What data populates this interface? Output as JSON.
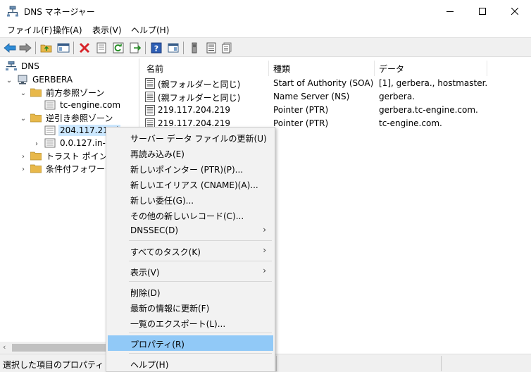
{
  "window": {
    "title": "DNS マネージャー",
    "minimize_glyph": "—",
    "maximize_glyph": "☐",
    "close_glyph": "✕"
  },
  "menubar": {
    "file": "ファイル(F)",
    "action": "操作(A)",
    "view": "表示(V)",
    "help": "ヘルプ(H)"
  },
  "toolbar": {
    "icons": [
      "back-icon",
      "forward-icon",
      "up-folder-icon",
      "show-hide-tree-icon",
      "delete-icon",
      "properties-icon",
      "refresh-icon",
      "export-list-icon",
      "help-icon",
      "console-view-icon",
      "server-icon",
      "record-list-icon",
      "new-record-icon"
    ]
  },
  "tree": {
    "root": "DNS",
    "server": "GERBERA",
    "forward_zones": "前方参照ゾーン",
    "forward_zone_1": "tc-engine.com",
    "reverse_zones": "逆引き参照ゾーン",
    "reverse_zone_1": "204.117.219.i",
    "reverse_zone_2": "0.0.127.in-ad",
    "trust_points": "トラスト ポイント",
    "conditional_forwarders": "条件付フォワーダー"
  },
  "list": {
    "headers": {
      "name": "名前",
      "type": "種類",
      "data": "データ"
    },
    "rows": [
      {
        "name": "(親フォルダーと同じ)",
        "type": "Start of Authority (SOA)",
        "data": "[1], gerbera., hostmaster."
      },
      {
        "name": "(親フォルダーと同じ)",
        "type": "Name Server (NS)",
        "data": "gerbera."
      },
      {
        "name": "219.117.204.219",
        "type": "Pointer (PTR)",
        "data": "gerbera.tc-engine.com."
      },
      {
        "name": "219.117.204.219",
        "type": "Pointer (PTR)",
        "data": "tc-engine.com."
      }
    ]
  },
  "context_menu": {
    "update_server_data": "サーバー データ ファイルの更新(U)",
    "reload": "再読み込み(E)",
    "new_ptr": "新しいポインター (PTR)(P)...",
    "new_cname": "新しいエイリアス (CNAME)(A)...",
    "new_delegation": "新しい委任(G)...",
    "other_new_records": "その他の新しいレコード(C)...",
    "dnssec": "DNSSEC(D)",
    "all_tasks": "すべてのタスク(K)",
    "view": "表示(V)",
    "delete": "削除(D)",
    "refresh": "最新の情報に更新(F)",
    "export_list": "一覧のエクスポート(L)...",
    "properties": "プロパティ(R)",
    "help": "ヘルプ(H)",
    "submenu_arrow": "›"
  },
  "statusbar": {
    "text": "選択した項目のプロパティ ダイア"
  },
  "colors": {
    "highlight": "#91c9f7",
    "tree_selection": "#cce8ff",
    "folder": "#e8b84a",
    "toolbar_bg": "#f0f0f0"
  }
}
